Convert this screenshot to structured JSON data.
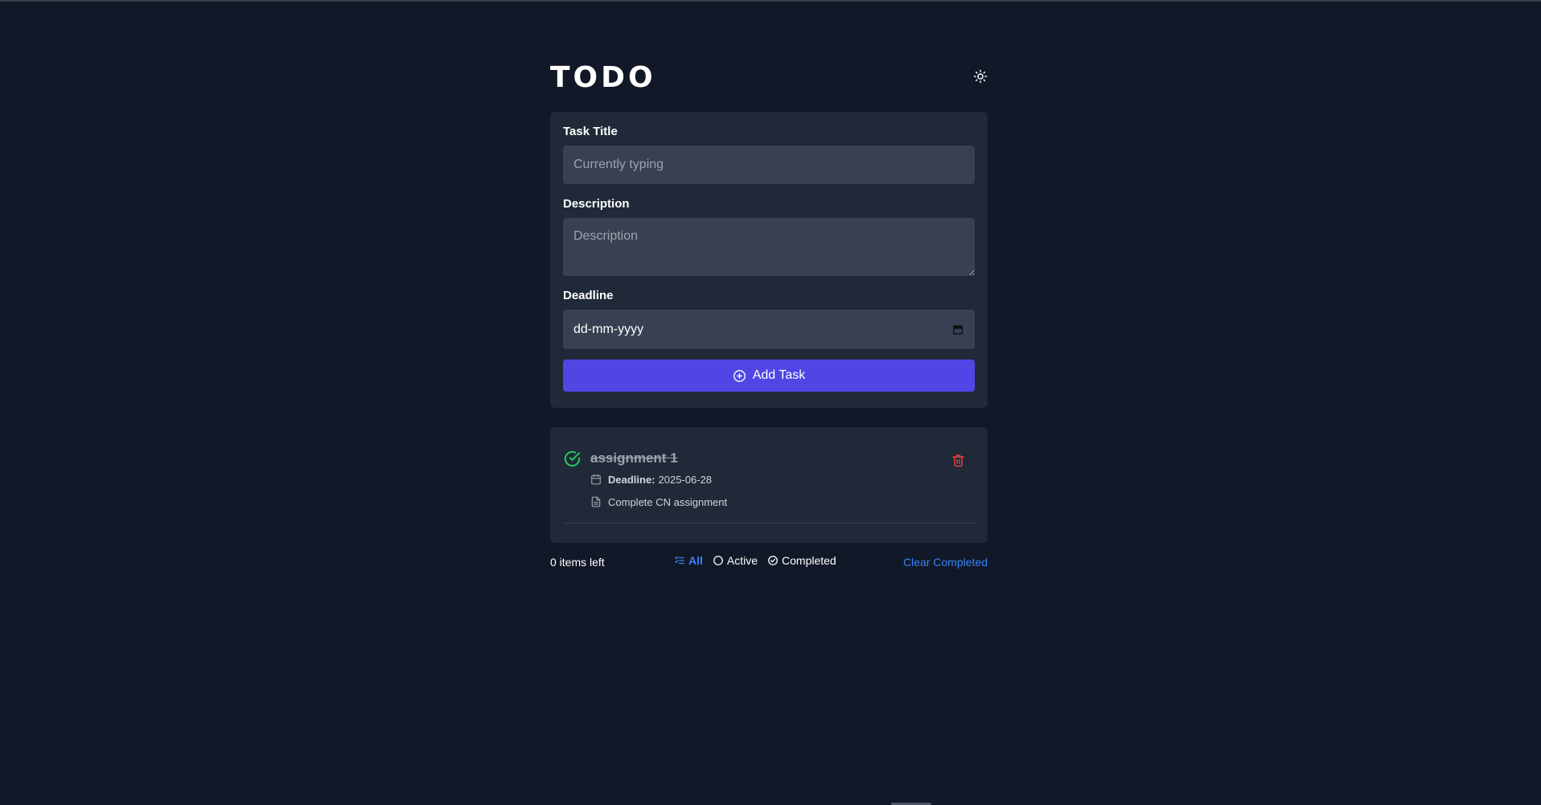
{
  "app": {
    "title": "TODO",
    "theme_toggle_icon": "sun-icon"
  },
  "form": {
    "task_title_label": "Task Title",
    "task_title_placeholder": "Currently typing",
    "description_label": "Description",
    "description_placeholder": "Description",
    "deadline_label": "Deadline",
    "deadline_placeholder": "dd-mm-yyyy",
    "add_button_label": "Add Task"
  },
  "tasks": [
    {
      "title": "assignment 1",
      "completed": true,
      "deadline_label": "Deadline:",
      "deadline": "2025-06-28",
      "description": "Complete CN assignment"
    }
  ],
  "footer": {
    "items_left": "0 items left",
    "filters": [
      {
        "label": "All",
        "active": true,
        "icon": "list-check-icon"
      },
      {
        "label": "Active",
        "active": false,
        "icon": "circle-icon"
      },
      {
        "label": "Completed",
        "active": false,
        "icon": "circle-check-icon"
      }
    ],
    "clear_completed": "Clear Completed"
  },
  "colors": {
    "background": "#111827",
    "card": "#1f2937",
    "input": "#374151",
    "accent": "#4f46e5",
    "link": "#3b82f6",
    "success": "#22c55e",
    "danger": "#ef4444"
  }
}
